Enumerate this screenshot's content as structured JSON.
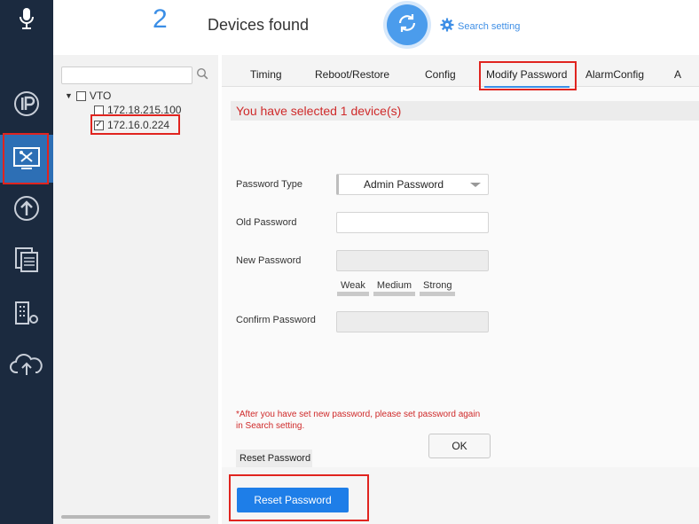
{
  "header": {
    "device_count": "2",
    "device_label": "Devices found",
    "search_setting": "Search setting"
  },
  "tree": {
    "root_label": "VTO",
    "devices": [
      {
        "ip": "172.18.215.100",
        "checked": false
      },
      {
        "ip": "172.16.0.224",
        "checked": true
      }
    ]
  },
  "tabs": [
    "Timing",
    "Reboot/Restore",
    "Config",
    "Modify Password",
    "AlarmConfig",
    "A"
  ],
  "active_tab": "Modify Password",
  "selected_message": "You have selected 1 device(s)",
  "form": {
    "password_type_label": "Password Type",
    "password_type_value": "Admin Password",
    "old_password_label": "Old Password",
    "new_password_label": "New Password",
    "strength": [
      "Weak",
      "Medium",
      "Strong"
    ],
    "confirm_password_label": "Confirm Password",
    "note_line1": "*After you have set new password, please set password again",
    "note_line2": "in Search setting.",
    "ok_label": "OK"
  },
  "reset": {
    "tab_label": "Reset Password",
    "button_label": "Reset Password"
  },
  "colors": {
    "sidebar_bg": "#1b2a3f",
    "sidebar_active": "#2d6fb5",
    "accent_blue": "#3a8ee6",
    "highlight_red": "#e0241f",
    "message_red": "#cf2a2a",
    "reset_button": "#1e7ee8"
  },
  "icons": [
    "microphone-icon",
    "ip-icon",
    "device-config-icon",
    "upgrade-icon",
    "batch-window-icon",
    "building-settings-icon",
    "cloud-upload-icon",
    "refresh-icon",
    "gear-icon",
    "search-icon"
  ]
}
